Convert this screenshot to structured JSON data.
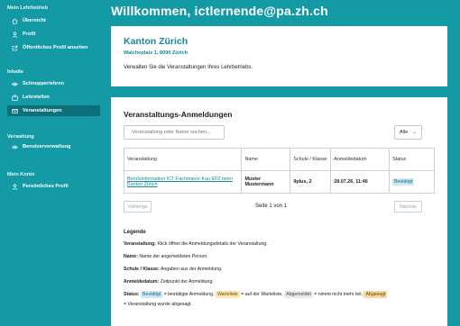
{
  "sidebar": {
    "sections": [
      {
        "title": "Mein Lehrbetrieb",
        "items": [
          {
            "label": "Übersicht",
            "icon": "home-icon"
          },
          {
            "label": "Profil",
            "icon": "user-icon"
          },
          {
            "label": "Öffentliches Profil ansehen",
            "icon": "external-link-icon"
          }
        ]
      },
      {
        "title": "Inhalte",
        "items": [
          {
            "label": "Schnupperlehren",
            "icon": "eye-icon"
          },
          {
            "label": "Lehrstellen",
            "icon": "briefcase-icon"
          },
          {
            "label": "Veranstaltungen",
            "icon": "mail-icon",
            "active": true
          }
        ]
      },
      {
        "title": "Verwaltung",
        "items": [
          {
            "label": "Benutzerverwaltung",
            "icon": "users-icon"
          }
        ]
      },
      {
        "title": "Mein Konto",
        "items": [
          {
            "label": "Persönliches Profil",
            "icon": "user-icon"
          }
        ]
      }
    ]
  },
  "header": {
    "title": "Willkommen, ictlernende@pa.zh.ch"
  },
  "org_card": {
    "name": "Kanton Zürich",
    "address": "Walcheplatz 1, 8090 Zürich",
    "intro": "Verwalten Sie die Veranstaltungen Ihres Lehrbetriebs."
  },
  "registrations": {
    "title": "Veranstaltungs-Anmeldungen",
    "search_placeholder": "Veranstaltung oder Name suchen...",
    "filter_value": "Alle",
    "columns": [
      "Veranstaltung",
      "Name",
      "Schule / Klasse",
      "Anmeldedatum",
      "Status"
    ],
    "rows": [
      {
        "event": "Berufsinformation ICT-Fachmann/-frau EFZ beim Kanton Zürich",
        "name": "Muster Mustermann",
        "school": "9plus, 2",
        "date": "28.07.26, 11:46",
        "status": "Bestätigt"
      }
    ],
    "prev_label": "Vorherige",
    "next_label": "Nächste",
    "page_info": "Seite 1 von 1"
  },
  "legend": {
    "title": "Legende",
    "event_key": "Veranstaltung:",
    "event_text": "Klick öffnet die Anmeldungsdetails der Veranstaltung.",
    "name_key": "Name:",
    "name_text": "Name der angemeldeten Person.",
    "school_key": "Schule / Klasse:",
    "school_text": "Angaben aus der Anmeldung.",
    "date_key": "Anmeldedatum:",
    "date_text": "Zeitpunkt der Anmeldung.",
    "status_key": "Status:",
    "status_ok": "Bestätigt",
    "status_ok_text": "= bestätigte Anmeldung,",
    "status_warte": "Warteliste",
    "status_warte_text": "= auf der Warteliste,",
    "status_abgemeldet": "Abgemeldet",
    "status_abgemeldet_text": "= nimmt nicht mehr teil,",
    "status_abgesagt": "Abgesagt",
    "status_abgesagt_text": "= Veranstaltung wurde abgesagt."
  },
  "colors": {
    "brand": "#149aa5",
    "active_nav": "#0d6f78",
    "accent_text": "#138a94"
  }
}
